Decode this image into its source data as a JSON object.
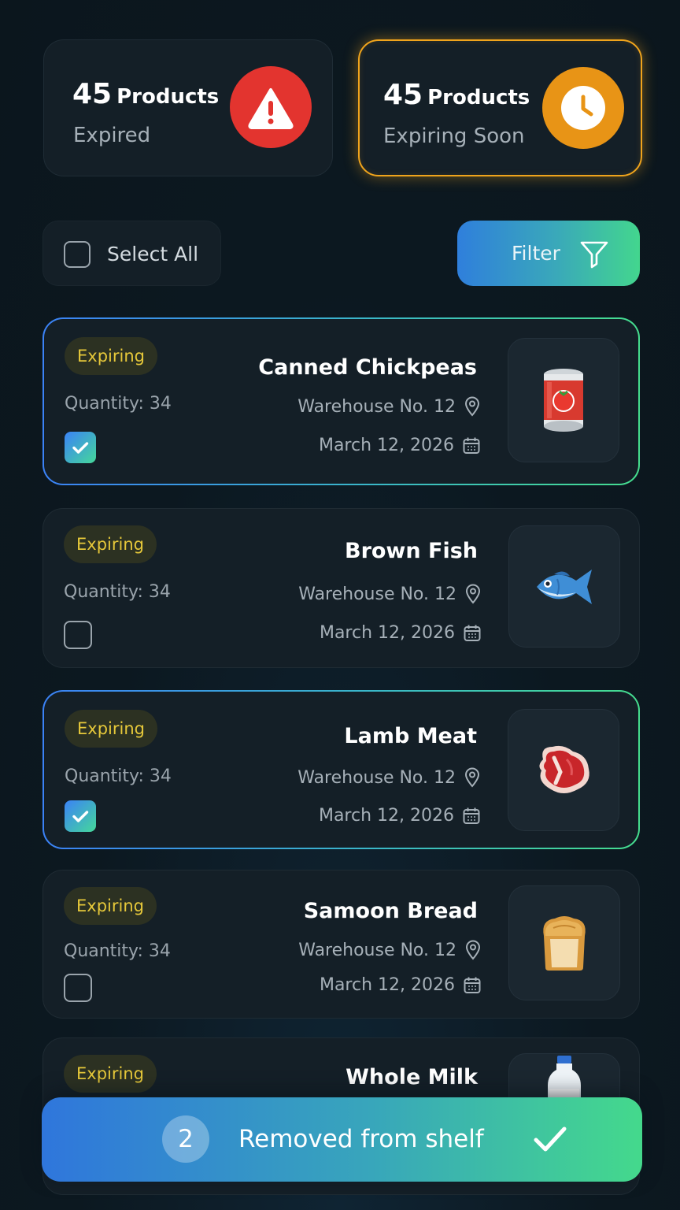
{
  "summary": {
    "expired": {
      "count": "45",
      "unit": "Products",
      "label": "Expired",
      "icon": "warning-triangle-icon",
      "color": "#e3342f"
    },
    "expiring_soon": {
      "count": "45",
      "unit": "Products",
      "label": "Expiring Soon",
      "icon": "clock-icon",
      "color": "#e89416"
    }
  },
  "controls": {
    "select_all_label": "Select All",
    "select_all_checked": false,
    "filter_label": "Filter",
    "filter_icon": "funnel-icon"
  },
  "products": [
    {
      "status": "Expiring",
      "quantity": "Quantity: 34",
      "name": "Canned Chickpeas",
      "location": "Warehouse No. 12",
      "date": "March 12, 2026",
      "selected": true,
      "image": "canned-food-icon"
    },
    {
      "status": "Expiring",
      "quantity": "Quantity: 34",
      "name": "Brown Fish",
      "location": "Warehouse No. 12",
      "date": "March 12, 2026",
      "selected": false,
      "image": "fish-icon"
    },
    {
      "status": "Expiring",
      "quantity": "Quantity: 34",
      "name": "Lamb Meat",
      "location": "Warehouse No. 12",
      "date": "March 12, 2026",
      "selected": true,
      "image": "meat-icon"
    },
    {
      "status": "Expiring",
      "quantity": "Quantity: 34",
      "name": "Samoon Bread",
      "location": "Warehouse No. 12",
      "date": "March 12, 2026",
      "selected": false,
      "image": "bread-icon"
    },
    {
      "status": "Expiring",
      "name": "Whole Milk",
      "image": "milk-bottle-icon"
    }
  ],
  "action_bar": {
    "count": "2",
    "label": "Removed from shelf",
    "icon": "checkmark-icon"
  },
  "colors": {
    "accent_gradient_start": "#2f7fdc",
    "accent_gradient_end": "#43d68e",
    "badge_text": "#e6c83a"
  }
}
